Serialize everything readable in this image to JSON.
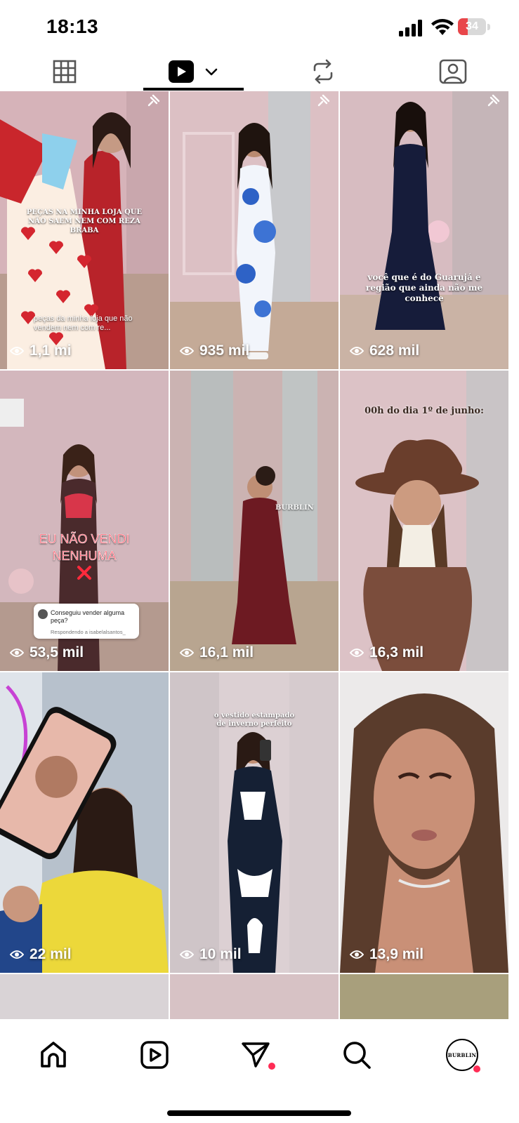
{
  "status_bar": {
    "time": "18:13",
    "battery": "34"
  },
  "colors": {
    "accent": "#000000",
    "notification_dot": "#ff2c55",
    "battery_fill": "#e8464a"
  },
  "tabs": [
    {
      "name": "grid",
      "icon": "grid-icon"
    },
    {
      "name": "reels",
      "icon": "reels-icon",
      "active": true
    },
    {
      "name": "reposts",
      "icon": "repost-icon"
    },
    {
      "name": "tagged",
      "icon": "tagged-icon"
    }
  ],
  "tiles": [
    {
      "views": "1,1 mi",
      "caption": "PEÇAS NA MINHA LOJA QUE NÃO SAEM NEM COM REZA BRABA",
      "caption2": "peças da minha loja que não vendem nem com re...",
      "pinned": true
    },
    {
      "views": "935 mil",
      "pinned": true
    },
    {
      "views": "628 mil",
      "caption": "você que é do Guarujá e região que ainda não me conhece",
      "pinned": true
    },
    {
      "views": "53,5 mil",
      "caption": "EU NÃO VENDI NENHUMA",
      "reply_question": "Conseguiu vender alguma peça?",
      "reply_to": "Respondendo a isabelalsantos_"
    },
    {
      "views": "16,1 mil",
      "watermark": "BURBLIN"
    },
    {
      "views": "16,3 mil",
      "caption": "00h do dia 1º de junho:"
    },
    {
      "views": "22 mil"
    },
    {
      "views": "10 mil",
      "caption": "o vestido estampado de inverno perfeito"
    },
    {
      "views": "13,9 mil"
    }
  ],
  "bottom_nav": [
    {
      "name": "home",
      "icon": "home-icon"
    },
    {
      "name": "reels",
      "icon": "reels-icon"
    },
    {
      "name": "direct",
      "icon": "send-icon",
      "badge": true
    },
    {
      "name": "search",
      "icon": "search-icon"
    },
    {
      "name": "profile",
      "icon": "profile-avatar",
      "label": "BURBLIN",
      "badge": true
    }
  ]
}
